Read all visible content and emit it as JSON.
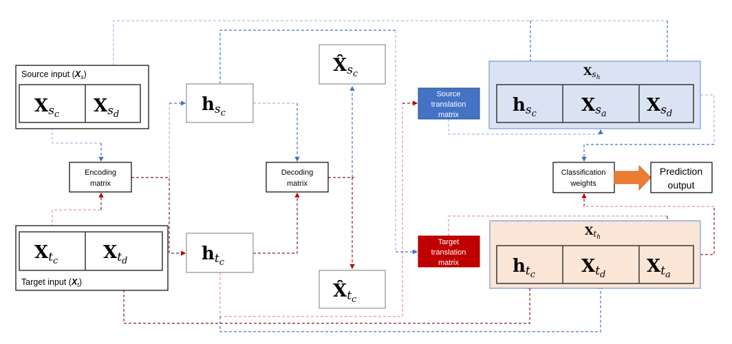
{
  "colors": {
    "source_blue": "#4472C4",
    "target_red": "#C00000",
    "source_panel": "#DAE3F3",
    "target_panel": "#FBE5D6",
    "arrow_orange": "#ED7D31"
  },
  "source_input": {
    "label": "Source input (",
    "label_sym": "X",
    "label_sub": "s",
    "label_end": ")",
    "cells": [
      {
        "main": "X",
        "sub": "s",
        "subsub": "c"
      },
      {
        "main": "X",
        "sub": "s",
        "subsub": "d"
      }
    ]
  },
  "target_input": {
    "label": "Target input (",
    "label_sym": "X",
    "label_sub": "t",
    "label_end": ")",
    "cells": [
      {
        "main": "X",
        "sub": "t",
        "subsub": "c"
      },
      {
        "main": "X",
        "sub": "t",
        "subsub": "d"
      }
    ]
  },
  "encoding": {
    "line1": "Encoding",
    "line2": "matrix"
  },
  "decoding": {
    "line1": "Decoding",
    "line2": "matrix"
  },
  "h_s": {
    "main": "h",
    "sub": "s",
    "subsub": "c"
  },
  "h_t": {
    "main": "h",
    "sub": "t",
    "subsub": "c"
  },
  "xhat_s": {
    "main": "X̂",
    "sub": "s",
    "subsub": "c"
  },
  "xhat_t": {
    "main": "X̂",
    "sub": "t",
    "subsub": "c"
  },
  "source_translation": {
    "line1": "Source",
    "line2": "translation",
    "line3": "matrix"
  },
  "target_translation": {
    "line1": "Target",
    "line2": "translation",
    "line3": "matrix"
  },
  "source_hybrid": {
    "title": {
      "main": "X",
      "sub": "s",
      "subsub": "h"
    },
    "cells": [
      {
        "main": "h",
        "sub": "s",
        "subsub": "c"
      },
      {
        "main": "X",
        "sub": "s",
        "subsub": "a"
      },
      {
        "main": "X",
        "sub": "s",
        "subsub": "d"
      }
    ]
  },
  "target_hybrid": {
    "title": {
      "main": "X",
      "sub": "t",
      "subsub": "h"
    },
    "cells": [
      {
        "main": "h",
        "sub": "t",
        "subsub": "c"
      },
      {
        "main": "X",
        "sub": "t",
        "subsub": "d"
      },
      {
        "main": "X",
        "sub": "t",
        "subsub": "a"
      }
    ]
  },
  "classification": {
    "line1": "Classification",
    "line2": "weights"
  },
  "prediction": {
    "line1": "Prediction",
    "line2": "output"
  }
}
